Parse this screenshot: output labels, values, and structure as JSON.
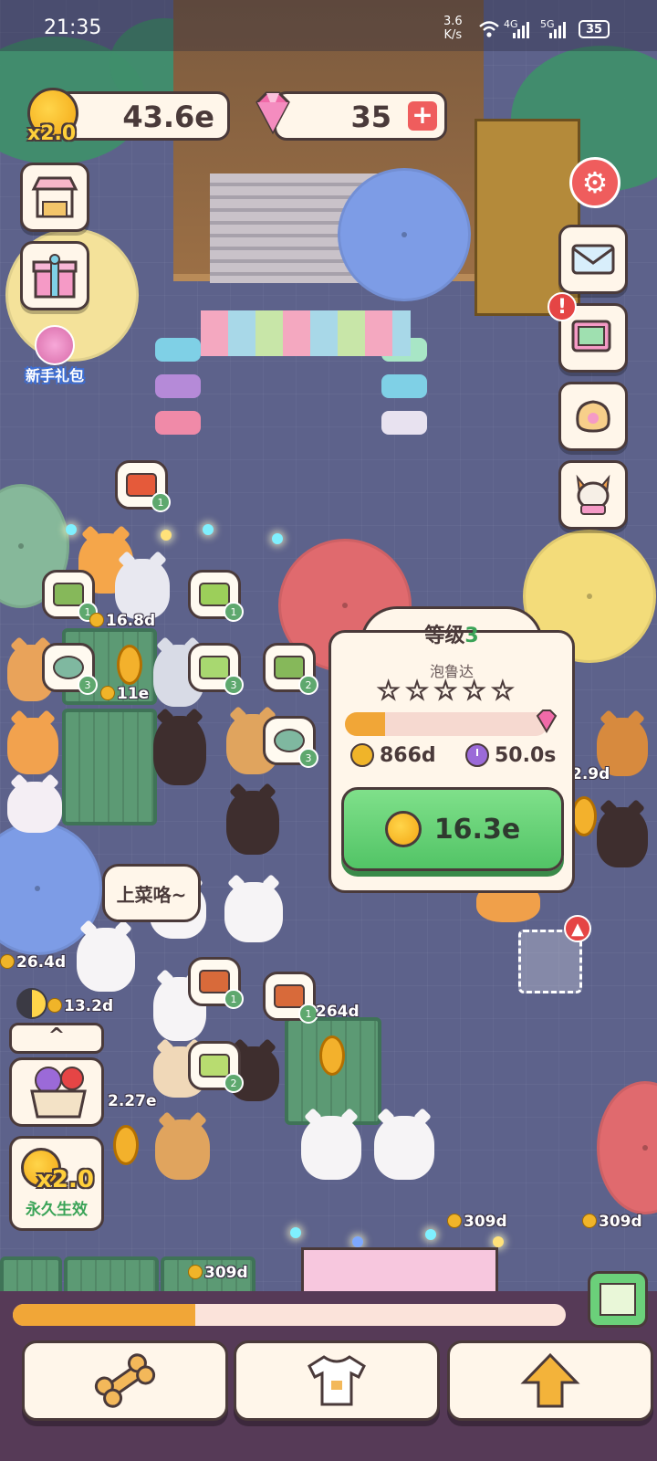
{
  "status_bar": {
    "time": "21:35",
    "net_speed_value": "3.6",
    "net_speed_unit": "K/s",
    "sim1": "4G",
    "sim2": "5G",
    "battery": "35"
  },
  "currency": {
    "coins": "43.6e",
    "multiplier": "x2.0",
    "gems": "35",
    "add_gems_icon": "plus-icon"
  },
  "left_menu": {
    "shop_icon": "shop-stall-icon",
    "gift_icon": "gift-box-icon",
    "newbie_pack_label": "新手礼包"
  },
  "right_menu": {
    "settings_icon": "gear-icon",
    "mail_icon": "envelope-icon",
    "photo_icon": "photo-album-icon",
    "alert_badge": "!",
    "food_icon": "bread-icon",
    "dog_icon": "corgi-icon"
  },
  "upgrade_popup": {
    "level_prefix": "等级",
    "level_number": "3",
    "item_name": "泡鲁达",
    "stars_total": 5,
    "stars_filled": 0,
    "progress_fraction": 0.2,
    "income": "866d",
    "cook_time": "50.0s",
    "upgrade_cost": "16.3e"
  },
  "earnings": [
    {
      "label": "16.8d"
    },
    {
      "label": "11e"
    },
    {
      "label": "26.4d"
    },
    {
      "label": "13.2d"
    },
    {
      "label": "264d"
    },
    {
      "label": "2.27e"
    },
    {
      "label": "309d"
    },
    {
      "label": "309d"
    },
    {
      "label": "309d"
    },
    {
      "label": "2.9d"
    }
  ],
  "order_bubbles": [
    {
      "count": "1"
    },
    {
      "count": "1"
    },
    {
      "count": "1"
    },
    {
      "count": "3"
    },
    {
      "count": "3"
    },
    {
      "count": "2"
    },
    {
      "count": "3"
    },
    {
      "count": "1"
    },
    {
      "count": "1"
    },
    {
      "count": "2"
    }
  ],
  "speech_bubble": "上菜咯~",
  "booster": {
    "multiplier": "x2.0",
    "label": "永久生效",
    "collapse_icon": "chevron-up-icon"
  },
  "bottom_bar": {
    "progress_fraction": 0.33,
    "map_icon": "map-icon",
    "nav": [
      {
        "icon": "bone-icon"
      },
      {
        "icon": "tshirt-icon"
      },
      {
        "icon": "arrow-up-icon"
      }
    ]
  },
  "colors": {
    "accent_green": "#52c466",
    "accent_orange": "#f1a637",
    "alert_red": "#e54545",
    "panel": "#fff6ea",
    "outline": "#4a3a3a"
  }
}
